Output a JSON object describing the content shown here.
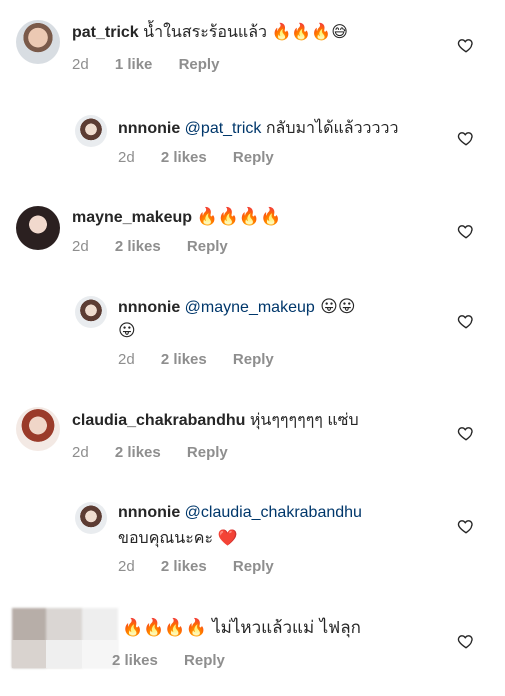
{
  "comments": [
    {
      "user": "pat_trick",
      "text": "น้ำในสระร้อนแล้ว 🔥🔥🔥😅",
      "time": "2d",
      "likes": "1 like",
      "reply": "Reply"
    },
    {
      "user": "nnnonie",
      "mention": "@pat_trick",
      "text": " กลับมาได้แล้ววววว",
      "time": "2d",
      "likes": "2 likes",
      "reply": "Reply"
    },
    {
      "user": "mayne_makeup",
      "text": "🔥🔥🔥🔥",
      "time": "2d",
      "likes": "2 likes",
      "reply": "Reply"
    },
    {
      "user": "nnnonie",
      "mention": "@mayne_makeup",
      "text": " 😛😛",
      "text2": "😛",
      "time": "2d",
      "likes": "2 likes",
      "reply": "Reply"
    },
    {
      "user": "claudia_chakrabandhu",
      "text": "หุ่นๆๆๆๆๆๆ แซ่บ",
      "time": "2d",
      "likes": "2 likes",
      "reply": "Reply"
    },
    {
      "user": "nnnonie",
      "mention": "@claudia_chakrabandhu",
      "text2": "ขอบคุณนะคะ ❤️",
      "time": "2d",
      "likes": "2 likes",
      "reply": "Reply"
    },
    {
      "text": "🔥🔥🔥🔥 ไม่ไหวแล้วแม่ ไฟลุก",
      "likes": "2 likes",
      "reply": "Reply"
    }
  ],
  "icons": {
    "like": "heart-outline-icon"
  }
}
